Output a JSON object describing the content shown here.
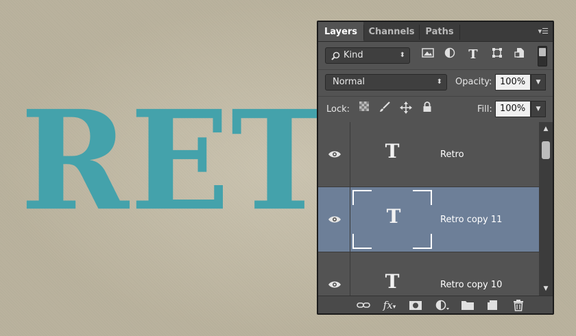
{
  "canvas": {
    "text": "RETRO",
    "text_color": "#44a2ab",
    "background": "#c4bca6"
  },
  "panel": {
    "tabs": [
      {
        "label": "Layers",
        "active": true
      },
      {
        "label": "Channels",
        "active": false
      },
      {
        "label": "Paths",
        "active": false
      }
    ],
    "filter": {
      "kind_label": "Kind",
      "icons": [
        "image-filter-icon",
        "adjustment-filter-icon",
        "type-filter-icon",
        "shape-filter-icon",
        "smart-object-filter-icon"
      ]
    },
    "blend": {
      "mode": "Normal",
      "opacity_label": "Opacity:",
      "opacity_value": "100%"
    },
    "lock": {
      "label": "Lock:",
      "icons": [
        "lock-transparent-icon",
        "lock-image-icon",
        "lock-position-icon",
        "lock-all-icon"
      ],
      "fill_label": "Fill:",
      "fill_value": "100%"
    },
    "layers": [
      {
        "name": "Retro",
        "type_glyph": "T",
        "selected": false
      },
      {
        "name": "Retro copy 11",
        "type_glyph": "T",
        "selected": true
      },
      {
        "name": "Retro copy 10",
        "type_glyph": "T",
        "selected": false
      }
    ],
    "footer_icons": [
      "link-layers-icon",
      "fx-icon",
      "layer-mask-icon",
      "adjustment-layer-icon",
      "group-folder-icon",
      "new-layer-icon",
      "trash-icon"
    ],
    "colors": {
      "panel": "#535353",
      "selected_row": "#6d7f98",
      "tab_bar": "#3b3b3b"
    }
  }
}
